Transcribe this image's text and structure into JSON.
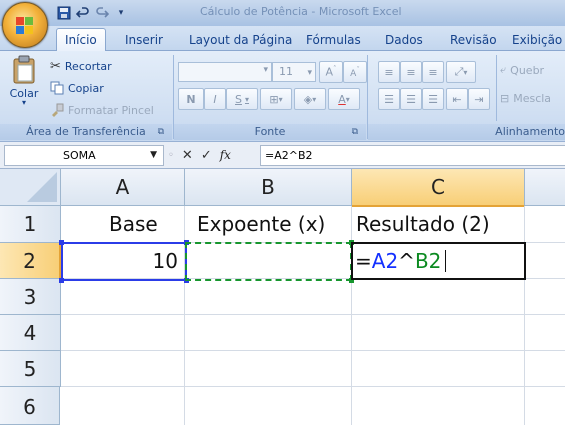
{
  "qat": {
    "save_icon": "save-icon",
    "undo_icon": "undo-icon",
    "redo_icon": "redo-icon"
  },
  "window_title": "Cálculo de Potência - Microsoft Excel",
  "tabs": [
    "Início",
    "Inserir",
    "Layout da Página",
    "Fórmulas",
    "Dados",
    "Revisão",
    "Exibição"
  ],
  "active_tab": "Início",
  "clipboard": {
    "paste_label": "Colar",
    "cut_label": "Recortar",
    "copy_label": "Copiar",
    "format_painter_label": "Formatar Pincel",
    "group_label": "Área de Transferência"
  },
  "font": {
    "size_value": "11",
    "bold_label": "N",
    "italic_label": "I",
    "underline_label": "S",
    "group_label": "Fonte"
  },
  "alignment": {
    "wrap_label": "Quebr",
    "merge_label": "Mescla",
    "group_label": "Alinhamento"
  },
  "formula_bar": {
    "name_box": "SOMA",
    "fx_label": "fx",
    "content": "=A2^B2"
  },
  "sheet": {
    "columns": [
      "A",
      "B",
      "C"
    ],
    "rows": [
      "1",
      "2",
      "3",
      "4",
      "5",
      "6"
    ],
    "cells": {
      "A1": "Base",
      "B1": "Expoente (x)",
      "C1": "Resultado (2)",
      "A2": "10",
      "C2_prefix": "=",
      "C2_ref1": "A2",
      "C2_op": "^",
      "C2_ref2": "B2"
    }
  },
  "colors": {
    "ref_blue": "#1330ff",
    "ref_green": "#0b8a20",
    "selection_header": "#f8cf77"
  }
}
